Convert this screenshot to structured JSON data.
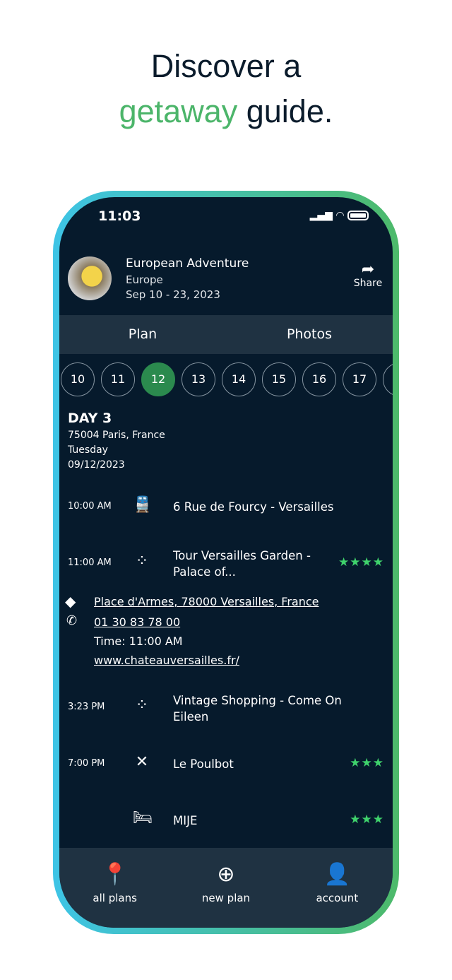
{
  "headline": {
    "line1": "Discover a",
    "highlight": "getaway",
    "rest": " guide."
  },
  "status": {
    "time": "11:03"
  },
  "trip": {
    "title": "European Adventure",
    "region": "Europe",
    "dates": "Sep 10 - 23, 2023",
    "share_label": "Share"
  },
  "tabs": [
    {
      "label": "Plan"
    },
    {
      "label": "Photos"
    }
  ],
  "days": [
    "10",
    "11",
    "12",
    "13",
    "14",
    "15",
    "16",
    "17"
  ],
  "selected_day": "12",
  "day": {
    "heading": "DAY 3",
    "location": "75004 Paris, France",
    "weekday": "Tuesday",
    "date": "09/12/2023"
  },
  "items": [
    {
      "time": "10:00 AM",
      "icon": "train-icon",
      "name": "6 Rue de Fourcy - Versailles",
      "stars": ""
    },
    {
      "time": "11:00 AM",
      "icon": "activity-icon",
      "name": "Tour Versailles Garden - Palace of...",
      "stars": "★★★★"
    },
    {
      "time": "3:23 PM",
      "icon": "activity-icon",
      "name": "Vintage Shopping - Come On Eileen",
      "stars": ""
    },
    {
      "time": "7:00 PM",
      "icon": "restaurant-icon",
      "name": "Le Poulbot",
      "stars": "★★★"
    },
    {
      "time": "",
      "icon": "bed-icon",
      "name": "MIJE",
      "stars": "★★★"
    }
  ],
  "details": {
    "address": "Place d'Armes, 78000 Versailles, France",
    "phone": "01 30 83 78 00",
    "time": "Time: 11:00 AM",
    "website": "www.chateauversailles.fr/"
  },
  "nav": [
    {
      "label": "all plans"
    },
    {
      "label": "new plan"
    },
    {
      "label": "account"
    }
  ],
  "colors": {
    "accent": "#2b8a4e",
    "stars": "#3fd26c",
    "background": "#061a2c"
  }
}
